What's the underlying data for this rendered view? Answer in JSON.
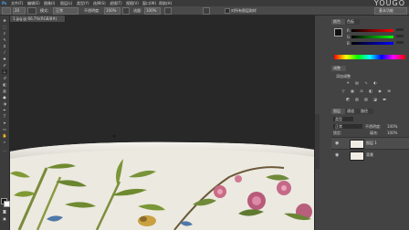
{
  "watermark": "YOUGO",
  "menu": [
    "文件(F)",
    "编辑(E)",
    "图像(I)",
    "图层(L)",
    "类型(Y)",
    "选择(S)",
    "滤镜(T)",
    "视图(V)",
    "窗口(W)",
    "帮助(H)"
  ],
  "options_bar": {
    "brush_size": "20",
    "mode_label": "模式:",
    "mode_value": "正常",
    "opacity_label": "不透明度:",
    "opacity_value": "100%",
    "flow_label": "流量:",
    "flow_value": "100%",
    "sample_all_layers": "对所有图层取样",
    "workspace": "基本功能"
  },
  "document_tab": "1.jpg @ 66.7%(RGB/8#)",
  "panels": {
    "color_tab": "颜色",
    "swatches_tab": "色板",
    "adjustments_tab": "调整",
    "adjustments_hint": "添加调整",
    "layers_tab": "图层",
    "channels_tab": "通道",
    "paths_tab": "路径",
    "kind_filter": "类型",
    "blend_mode": "正常",
    "opacity_label": "不透明度:",
    "opacity_value": "100%",
    "lock_label": "锁定:",
    "fill_label": "填充:",
    "fill_value": "100%"
  },
  "layers": [
    {
      "name": "图层 1",
      "visible": true
    },
    {
      "name": "背景",
      "visible": true
    }
  ],
  "colors": {
    "foreground": "#111111",
    "background": "#ffffff",
    "ui_dark": "#282828",
    "panel": "#434343"
  }
}
